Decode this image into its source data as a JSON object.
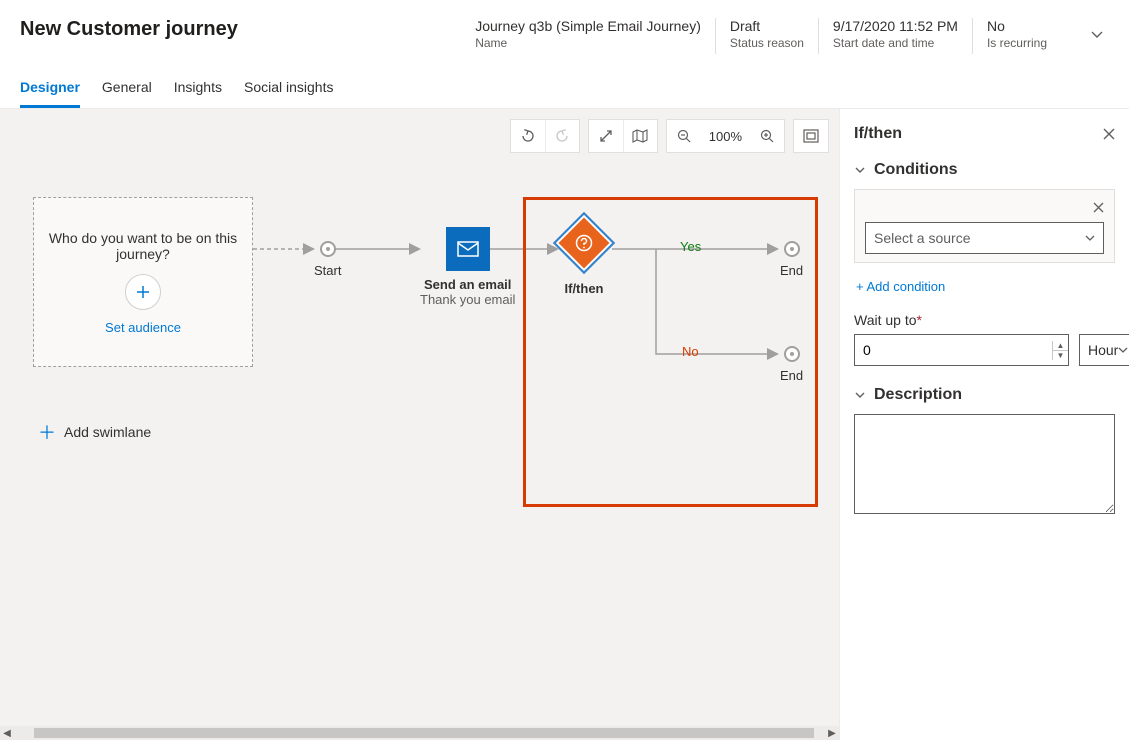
{
  "header": {
    "page_title": "New Customer journey",
    "fields": [
      {
        "value": "Journey q3b (Simple Email Journey)",
        "label": "Name"
      },
      {
        "value": "Draft",
        "label": "Status reason"
      },
      {
        "value": "9/17/2020 11:52 PM",
        "label": "Start date and time"
      },
      {
        "value": "No",
        "label": "Is recurring"
      }
    ]
  },
  "tabs": [
    {
      "label": "Designer",
      "active": true
    },
    {
      "label": "General",
      "active": false
    },
    {
      "label": "Insights",
      "active": false
    },
    {
      "label": "Social insights",
      "active": false
    }
  ],
  "toolbar": {
    "zoom_label": "100%"
  },
  "canvas": {
    "audience_question": "Who do you want to be on this journey?",
    "set_audience": "Set audience",
    "start_label": "Start",
    "email_title": "Send an email",
    "email_subtitle": "Thank you email",
    "ifthen_label": "If/then",
    "branch_yes": "Yes",
    "branch_no": "No",
    "end_label": "End",
    "add_swimlane": "Add swimlane"
  },
  "panel": {
    "title": "If/then",
    "conditions_heading": "Conditions",
    "source_placeholder": "Select a source",
    "add_condition": "+ Add condition",
    "wait_label": "Wait up to",
    "wait_value": "0",
    "wait_unit": "Hour",
    "description_heading": "Description",
    "description_value": ""
  }
}
